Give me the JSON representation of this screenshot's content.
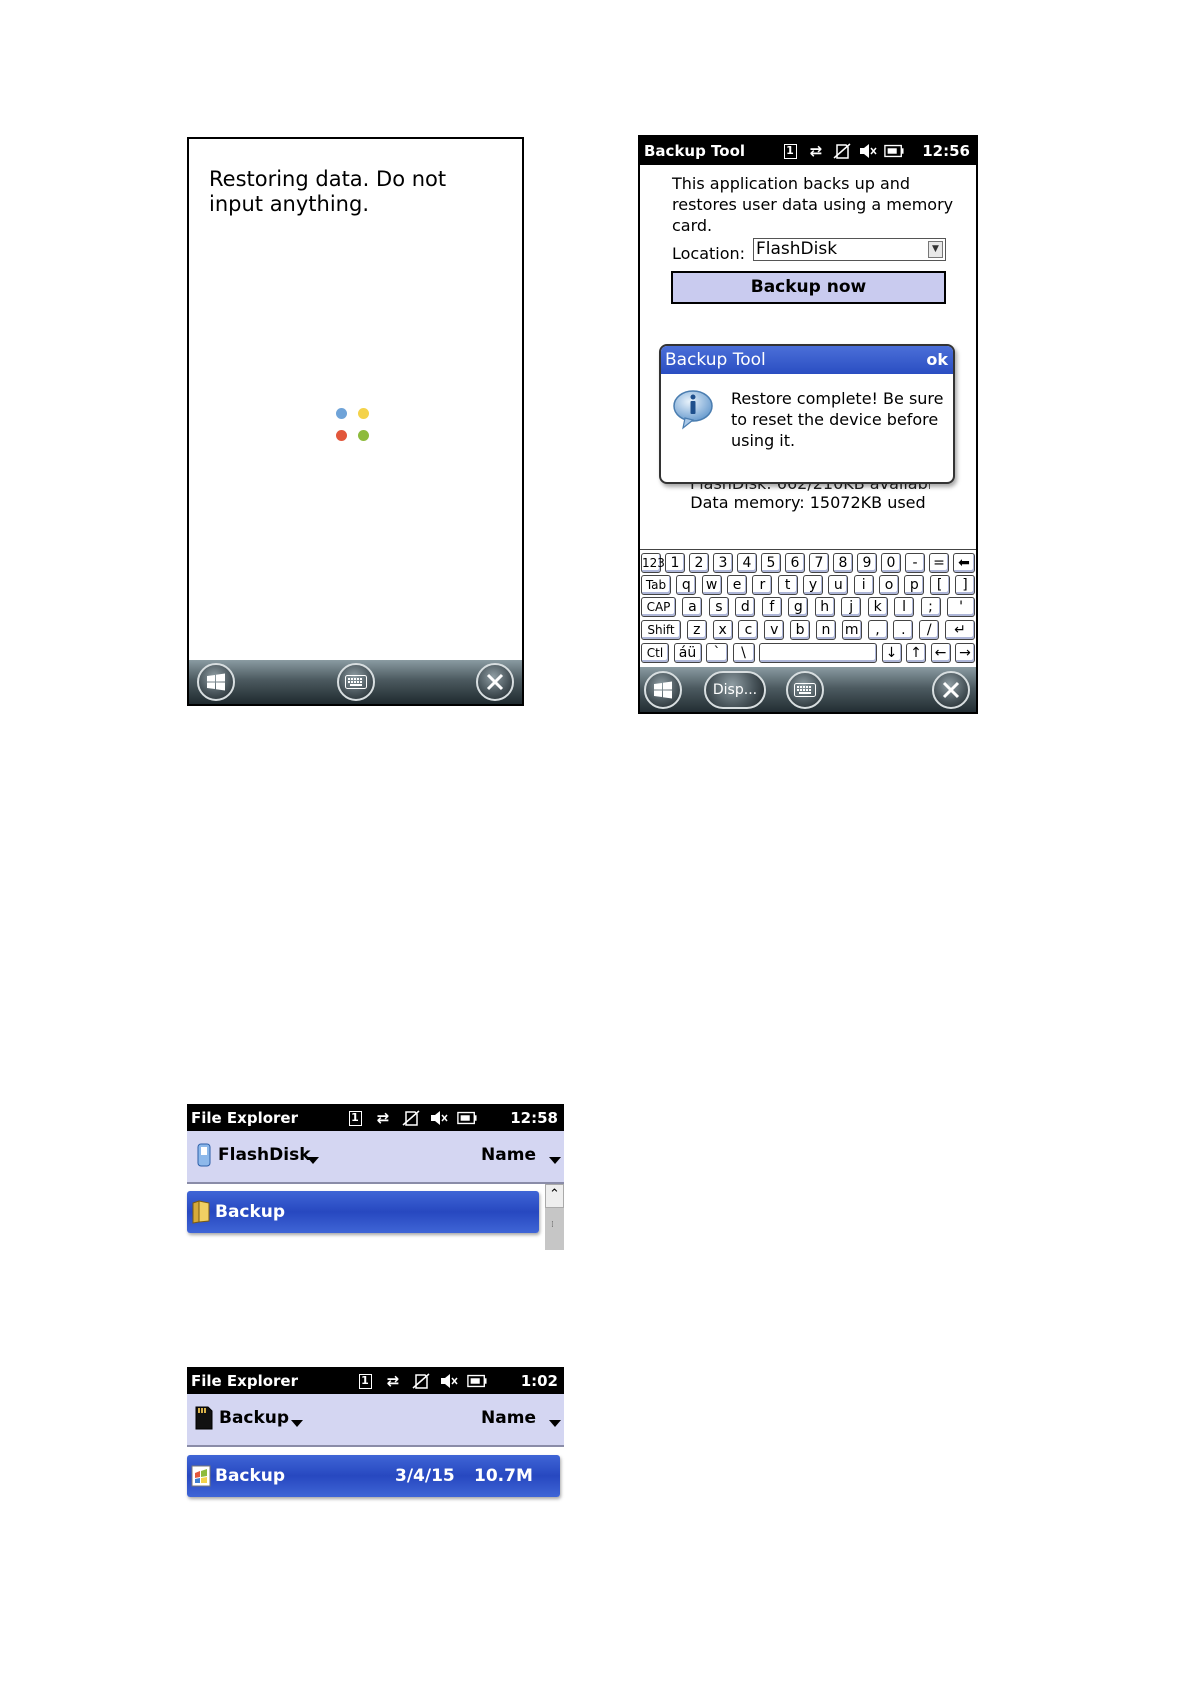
{
  "screen1": {
    "message": "Restoring data. Do not input anything."
  },
  "screen2": {
    "title": "Backup Tool",
    "time": "12:56",
    "sim_slot": "1",
    "description": "This application backs up and restores user data using a memory card.",
    "location_label": "Location:",
    "location_value": "FlashDisk",
    "backup_button": "Backup now",
    "dialog": {
      "title": "Backup Tool",
      "ok": "ok",
      "message": "Restore complete! Be sure to reset the device before using it."
    },
    "partial_text": "FlashDisk: 662/210KB available",
    "data_memory": "Data memory: 15072KB used",
    "keyboard": {
      "row1": [
        "123",
        "1",
        "2",
        "3",
        "4",
        "5",
        "6",
        "7",
        "8",
        "9",
        "0",
        "-",
        "=",
        "⬅"
      ],
      "row2": [
        "Tab",
        "q",
        "w",
        "e",
        "r",
        "t",
        "y",
        "u",
        "i",
        "o",
        "p",
        "[",
        "]"
      ],
      "row3": [
        "CAP",
        "a",
        "s",
        "d",
        "f",
        "g",
        "h",
        "j",
        "k",
        "l",
        ";",
        "'"
      ],
      "row4": [
        "Shift",
        "z",
        "x",
        "c",
        "v",
        "b",
        "n",
        "m",
        ",",
        ".",
        "/",
        "↵"
      ],
      "row5": [
        "Ctl",
        "áü",
        "`",
        "\\",
        " ",
        "↓",
        "↑",
        "←",
        "→"
      ]
    },
    "taskbar_disp": "Disp..."
  },
  "explorer1": {
    "title": "File Explorer",
    "time": "12:58",
    "sim_slot": "1",
    "folder": "FlashDisk",
    "sort": "Name",
    "row": {
      "name": "Backup"
    }
  },
  "explorer2": {
    "title": "File Explorer",
    "time": "1:02",
    "sim_slot": "1",
    "folder": "Backup",
    "sort": "Name",
    "row": {
      "name": "Backup",
      "date": "3/4/15",
      "size": "10.7M"
    }
  },
  "colors": {
    "selection_blue": "#2f52c8",
    "header_lavender": "#d4d6f2",
    "button_lavender": "#c9cbef",
    "dialog_blue": "#3a5fd0"
  }
}
